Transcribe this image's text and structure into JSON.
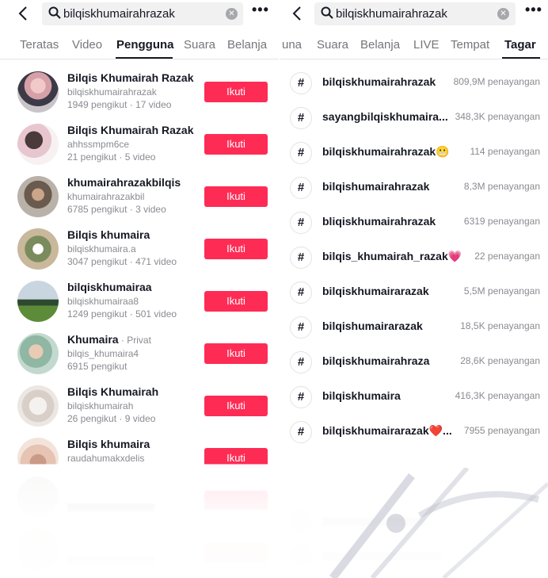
{
  "left": {
    "search_query": "bilqiskhumairahrazak",
    "more_label": "•••",
    "tabs": [
      "Teratas",
      "Video",
      "Pengguna",
      "Suara",
      "Belanja"
    ],
    "active_tab": "Pengguna",
    "follow_label": "Ikuti",
    "users": [
      {
        "name": "Bilqis Khumairah Razak",
        "private": "",
        "handle": "bilqiskhumairahrazak",
        "stats": "1949 pengikut · 17 video"
      },
      {
        "name": "Bilqis Khumairah Razak",
        "private": "",
        "handle": "ahhssmpm6ce",
        "stats": "21 pengikut · 5 video"
      },
      {
        "name": "khumairahrazakbilqis",
        "private": "",
        "handle": "khumairahrazakbil",
        "stats": "6785 pengikut · 3 video"
      },
      {
        "name": "Bilqis khumaira",
        "private": "",
        "handle": "bilqiskhumaira.a",
        "stats": "3047 pengikut · 471 video"
      },
      {
        "name": "bilqiskhumairaa",
        "private": "",
        "handle": "bilqiskhumairaa8",
        "stats": "1249 pengikut · 501 video"
      },
      {
        "name": "Khumaira",
        "private": " · Privat",
        "handle": "bilqis_khumaira4",
        "stats": "6915 pengikut"
      },
      {
        "name": "Bilqis Khumairah",
        "private": "",
        "handle": "bilqiskhumairah",
        "stats": "26 pengikut · 9 video"
      },
      {
        "name": "Bilqis khumaira",
        "private": "",
        "handle": "raudahumakxdelis",
        "stats": ""
      }
    ]
  },
  "right": {
    "search_query": "bilqiskhumairahrazak",
    "more_label": "•••",
    "tabs": [
      "una",
      "Suara",
      "Belanja",
      "LIVE",
      "Tempat",
      "Tagar"
    ],
    "active_tab": "Tagar",
    "hashtags": [
      {
        "name": "bilqiskhumairahrazak",
        "emoji": "",
        "views": "809,9M penayangan"
      },
      {
        "name": "sayangbilqiskhumaira...",
        "emoji": "",
        "views": "348,3K penayangan"
      },
      {
        "name": "bilqiskhumairahrazak",
        "emoji": "😬",
        "views": "114 penayangan"
      },
      {
        "name": "bilqishumairahrazak",
        "emoji": "",
        "views": "8,3M penayangan"
      },
      {
        "name": "bliqiskhumairahrazak",
        "emoji": "",
        "views": "6319 penayangan"
      },
      {
        "name": "bilqis_khumairah_razak",
        "emoji": "💗",
        "views": "22 penayangan"
      },
      {
        "name": "bilqiskhumairarazak",
        "emoji": "",
        "views": "5,5M penayangan"
      },
      {
        "name": "bilqishumairarazak",
        "emoji": "",
        "views": "18,5K penayangan"
      },
      {
        "name": "bilqiskhumairahraza",
        "emoji": "",
        "views": "28,6K penayangan"
      },
      {
        "name": "bilqiskhumaira",
        "emoji": "",
        "views": "416,3K penayangan"
      },
      {
        "name": "bilqiskhumairarazak",
        "emoji": "❤️...",
        "views": "7955 penayangan"
      }
    ]
  },
  "colors": {
    "accent": "#fe2c55",
    "text": "#161823",
    "muted": "#8a8b91"
  },
  "icons": {
    "back": "chevron-left-icon",
    "search": "search-icon",
    "clear": "clear-icon",
    "more": "more-icon",
    "hashtag": "hashtag-icon"
  }
}
